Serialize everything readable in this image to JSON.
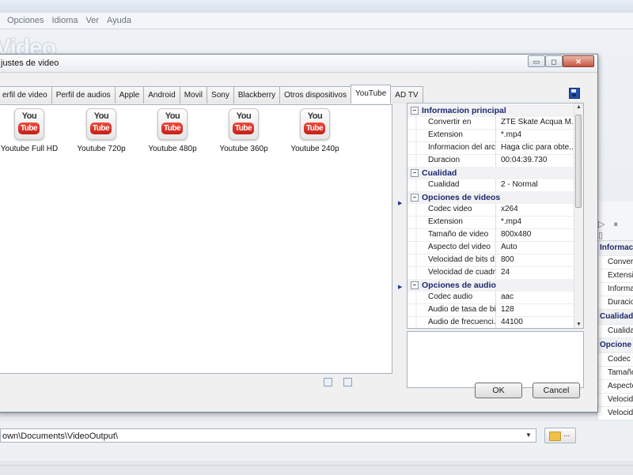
{
  "app": {
    "menu": [
      "Opciones",
      "Idioma",
      "Ver",
      "Ayuda"
    ],
    "logo_text": "Video",
    "output_path": "own\\Documents\\VideoOutput\\",
    "browse_label": "...",
    "player_controls": "▷ ⏸ ▯",
    "right_grid": [
      {
        "type": "section",
        "label": "Informac"
      },
      {
        "type": "row",
        "label": "Convert"
      },
      {
        "type": "row",
        "label": "Extensi"
      },
      {
        "type": "row",
        "label": "Informa"
      },
      {
        "type": "row",
        "label": "Duracio"
      },
      {
        "type": "section",
        "label": "Cualidad"
      },
      {
        "type": "row",
        "label": "Cualida"
      },
      {
        "type": "section",
        "label": "Opcione"
      },
      {
        "type": "row",
        "label": "Codec v"
      },
      {
        "type": "row",
        "label": "Tamaño"
      },
      {
        "type": "row",
        "label": "Aspecto"
      },
      {
        "type": "row",
        "label": "Velocida"
      },
      {
        "type": "row",
        "label": "Velocida"
      }
    ]
  },
  "dialog": {
    "title": "justes de video",
    "tabs": [
      "erfil de video",
      "Perfil de audios",
      "Apple",
      "Android",
      "Movil",
      "Sony",
      "Blackberry",
      "Otros dispositivos",
      "YouTube",
      "AD TV"
    ],
    "active_tab": "YouTube",
    "presets": [
      {
        "label": "Youtube Full HD",
        "icon_top": "You",
        "icon_bottom": "Tube"
      },
      {
        "label": "Youtube 720p",
        "icon_top": "You",
        "icon_bottom": "Tube"
      },
      {
        "label": "Youtube 480p",
        "icon_top": "You",
        "icon_bottom": "Tube"
      },
      {
        "label": "Youtube 360p",
        "icon_top": "You",
        "icon_bottom": "Tube"
      },
      {
        "label": "Youtube 240p",
        "icon_top": "You",
        "icon_bottom": "Tube"
      }
    ],
    "properties": [
      {
        "type": "section",
        "label": "Informacion principal"
      },
      {
        "type": "row",
        "label": "Convertir en",
        "value": "ZTE Skate Acqua M..."
      },
      {
        "type": "row",
        "label": "Extension",
        "value": "*.mp4"
      },
      {
        "type": "row",
        "label": "Informacion del arc...",
        "value": "Haga clic para obte..."
      },
      {
        "type": "row",
        "label": "Duracion",
        "value": "00:04:39.730"
      },
      {
        "type": "section",
        "label": "Cualidad"
      },
      {
        "type": "row",
        "label": "Cualidad",
        "value": "2 - Normal"
      },
      {
        "type": "section",
        "label": "Opciones de videos"
      },
      {
        "type": "row",
        "label": "Codec video",
        "value": "x264"
      },
      {
        "type": "row",
        "label": "Extension",
        "value": "*.mp4"
      },
      {
        "type": "row",
        "label": "Tamaño de video",
        "value": "800x480"
      },
      {
        "type": "row",
        "label": "Aspecto del video",
        "value": "Auto"
      },
      {
        "type": "row",
        "label": "Velocidad de bits d...",
        "value": "800"
      },
      {
        "type": "row",
        "label": "Velocidad de cuadr...",
        "value": "24"
      },
      {
        "type": "section",
        "label": "Opciones de audio"
      },
      {
        "type": "row",
        "label": "Codec audio",
        "value": "aac"
      },
      {
        "type": "row",
        "label": "Audio de tasa de bits",
        "value": "128"
      },
      {
        "type": "row",
        "label": "Audio de frecuenci...",
        "value": "44100"
      }
    ],
    "ok_label": "OK",
    "cancel_label": "Cancel",
    "window_buttons": {
      "minimize": "▭",
      "restore": "◻",
      "close": "✕"
    },
    "colors": {
      "section_text": "#1c2870",
      "youtube_red": "#d62a1f",
      "dialog_border": "#6f7f92"
    }
  }
}
